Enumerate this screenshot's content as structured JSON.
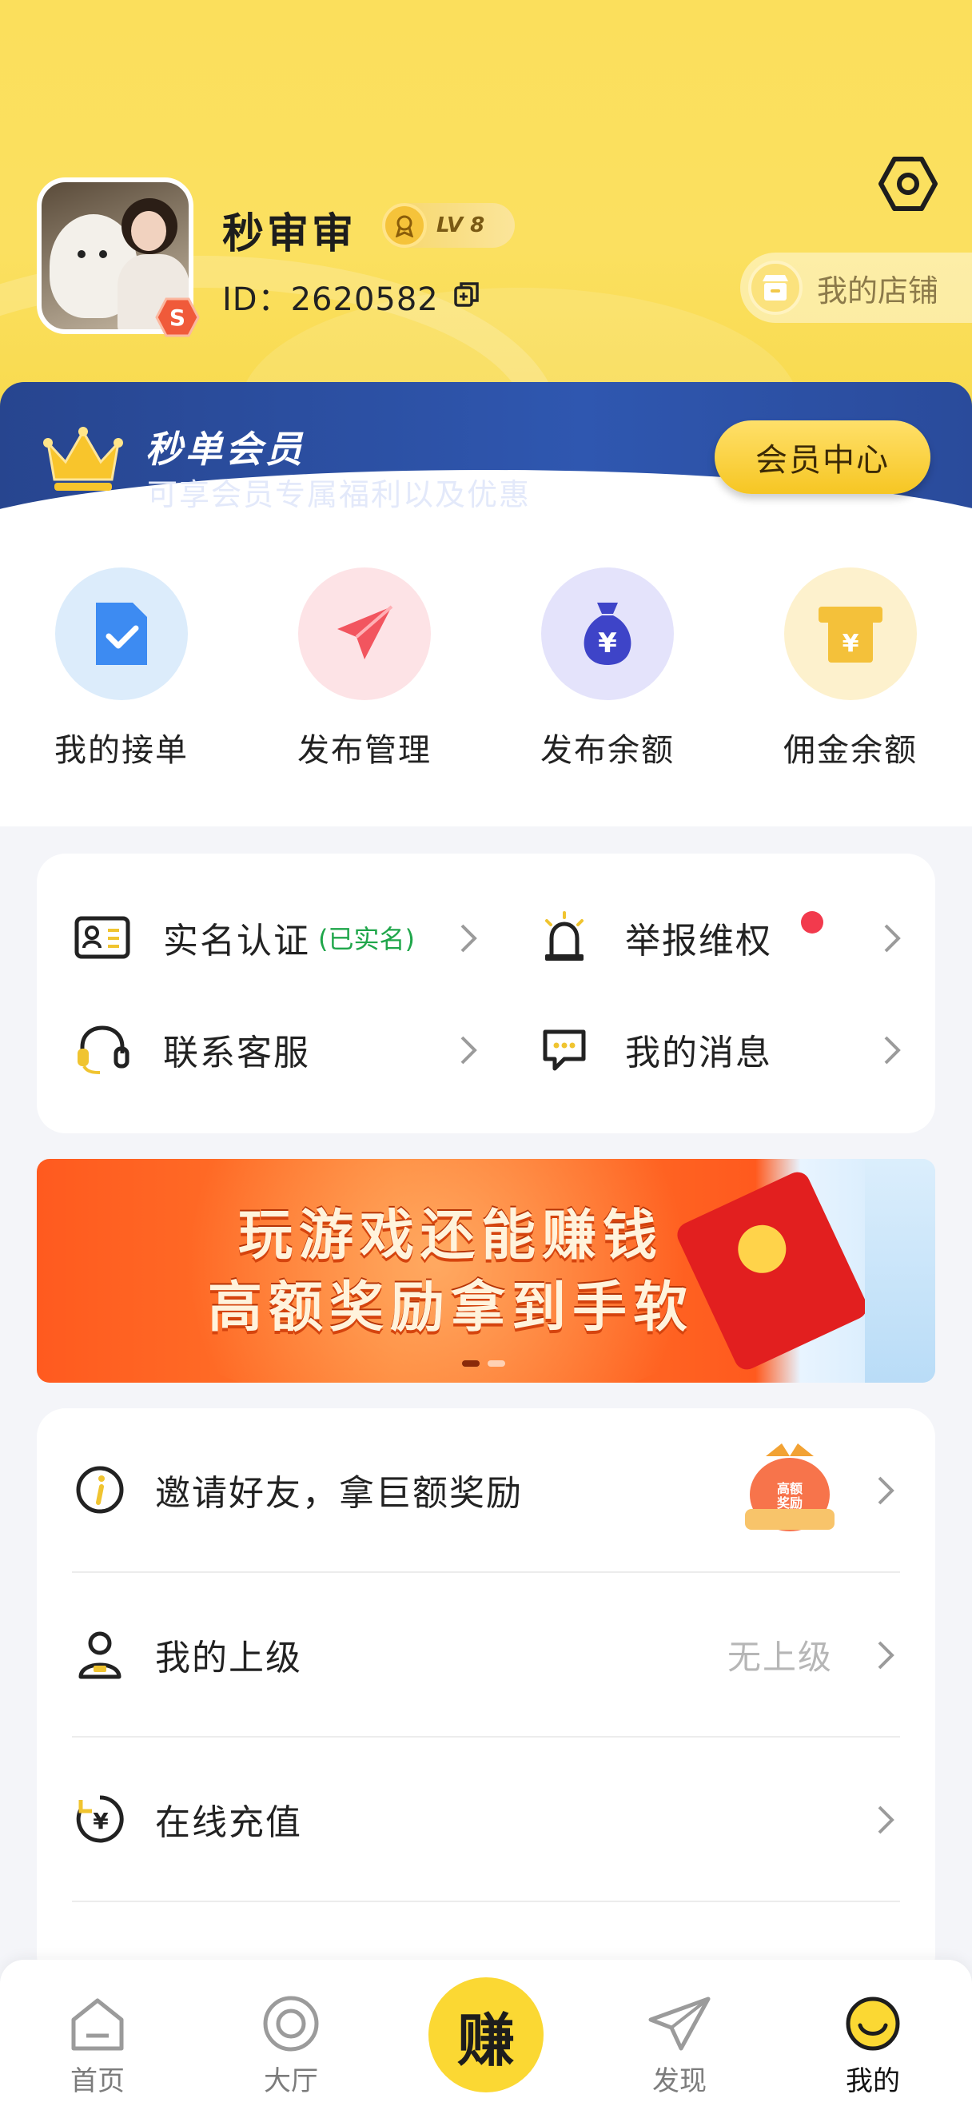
{
  "profile": {
    "username": "秒审审",
    "level": "LV 8",
    "id_label": "ID：2620582",
    "shop_label": "我的店铺"
  },
  "member": {
    "title": "秒单会员",
    "subtitle": "可享会员专属福利以及优惠",
    "button": "会员中心"
  },
  "quick_actions": [
    {
      "label": "我的接单",
      "icon": "document-check-icon",
      "color": "#dcecfb"
    },
    {
      "label": "发布管理",
      "icon": "paper-plane-icon",
      "color": "#fde3e6"
    },
    {
      "label": "发布余额",
      "icon": "money-bag-icon",
      "color": "#e4e3fb"
    },
    {
      "label": "佣金余额",
      "icon": "wallet-icon",
      "color": "#fdf1cd"
    }
  ],
  "services": {
    "verify": {
      "label": "实名认证",
      "tag": "(已实名)"
    },
    "report": {
      "label": "举报维权"
    },
    "support": {
      "label": "联系客服"
    },
    "messages": {
      "label": "我的消息"
    }
  },
  "ad_banner": {
    "line1": "玩游戏还能赚钱",
    "line2": "高额奖励拿到手软"
  },
  "list": {
    "invite": {
      "label": "邀请好友，拿巨额奖励",
      "badge_text": "高额奖励"
    },
    "superior": {
      "label": "我的上级",
      "value": "无上级"
    },
    "recharge": {
      "label": "在线充值"
    }
  },
  "tabbar": {
    "home": "首页",
    "hall": "大厅",
    "earn": "赚",
    "discover": "发现",
    "mine": "我的"
  },
  "colors": {
    "brand_yellow": "#fbd833",
    "member_blue": "#2f57b0",
    "verified_green": "#1fa64a",
    "alert_red": "#f23a4d"
  }
}
